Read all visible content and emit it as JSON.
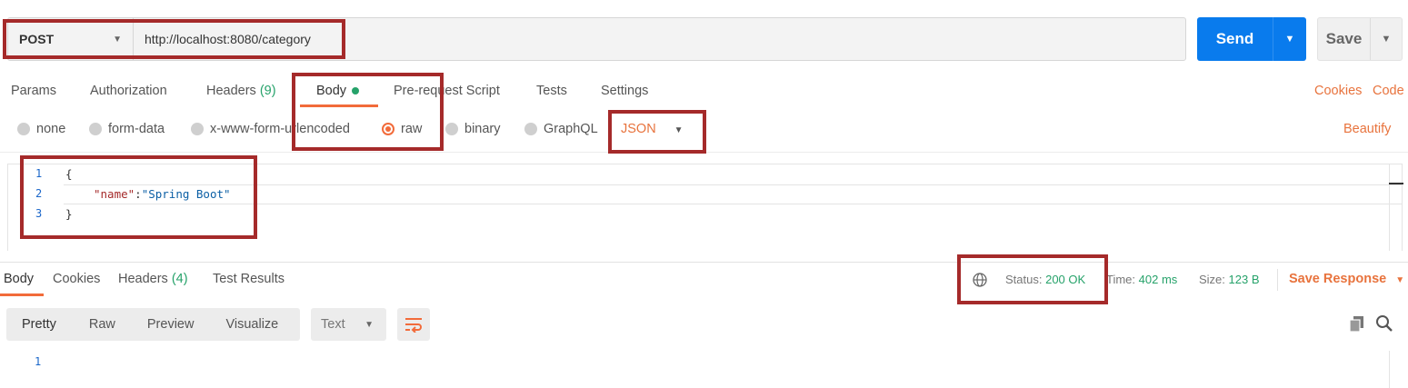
{
  "request": {
    "method": "POST",
    "url": "http://localhost:8080/category",
    "send_label": "Send",
    "save_label": "Save"
  },
  "request_tabs": {
    "params": "Params",
    "authorization": "Authorization",
    "headers": "Headers",
    "headers_count": "(9)",
    "body": "Body",
    "prerequest": "Pre-request Script",
    "tests": "Tests",
    "settings": "Settings",
    "cookies": "Cookies",
    "code": "Code"
  },
  "body_types": {
    "none": "none",
    "form_data": "form-data",
    "urlencoded": "x-www-form-urlencoded",
    "raw": "raw",
    "binary": "binary",
    "graphql": "GraphQL",
    "selected": "raw",
    "format": "JSON",
    "beautify": "Beautify"
  },
  "editor": {
    "line_numbers": [
      "1",
      "2",
      "3"
    ],
    "line1": "{",
    "line2_key": "\"name\"",
    "line2_colon": ":",
    "line2_value": "\"Spring Boot\"",
    "line3": "}"
  },
  "response_tabs": {
    "body": "Body",
    "cookies": "Cookies",
    "headers": "Headers",
    "headers_count": "(4)",
    "test_results": "Test Results"
  },
  "response_meta": {
    "status_label": "Status:",
    "status_value": "200 OK",
    "time_label": "Time:",
    "time_value": "402 ms",
    "size_label": "Size:",
    "size_value": "123 B",
    "save_response": "Save Response"
  },
  "response_view": {
    "pretty": "Pretty",
    "raw": "Raw",
    "preview": "Preview",
    "visualize": "Visualize",
    "format": "Text",
    "line_number": "1"
  },
  "colors": {
    "accent": "#f26b3a",
    "send": "#097bed",
    "success": "#26a26a",
    "highlight_box": "#a52a2a"
  }
}
